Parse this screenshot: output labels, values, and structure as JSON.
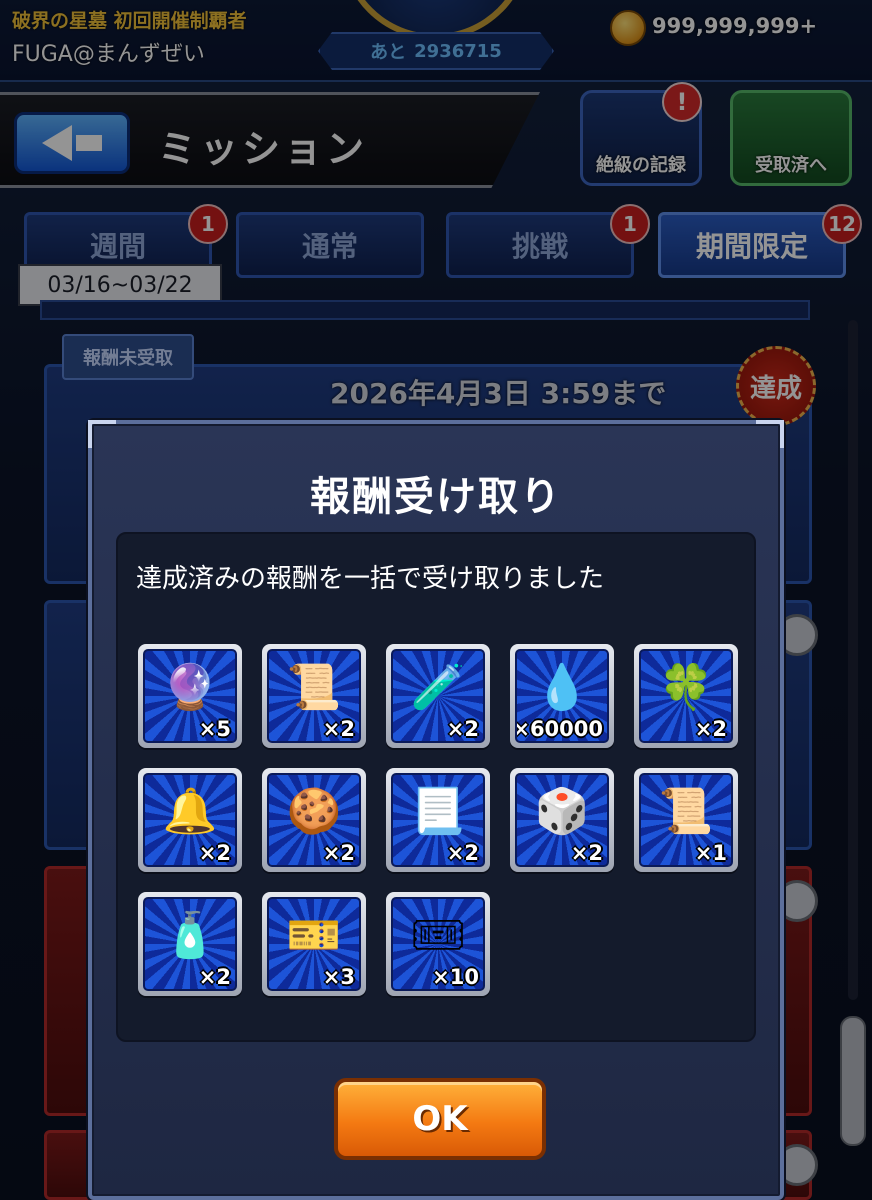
{
  "header": {
    "title_text": "破界の星墓 初回開催制覇者",
    "user_name": "FUGA@まんずぜい",
    "remaining_label": "あと",
    "remaining_value": "2936715",
    "coin_amount": "999,999,999+"
  },
  "mission_bar": {
    "title": "ミッション",
    "records_label": "絶級の記録",
    "records_alert": "!",
    "claimed_label": "受取済へ"
  },
  "tabs": [
    {
      "label": "週間",
      "badge": "1"
    },
    {
      "label": "通常",
      "badge": ""
    },
    {
      "label": "挑戦",
      "badge": "1"
    },
    {
      "label": "期間限定",
      "badge": "12"
    }
  ],
  "date_range": "03/16~03/22",
  "list": {
    "unclaimed_tag": "報酬未受取",
    "deadline": "2026年4月3日 3:59まで",
    "achieved_stamp": "達成"
  },
  "modal": {
    "title": "報酬受け取り",
    "message": "達成済みの報酬を一括で受け取りました",
    "ok_label": "OK",
    "rewards": [
      {
        "icon": "rainbow-orb-icon",
        "glyph": "🔮",
        "qty": "×5"
      },
      {
        "icon": "scroll-icon",
        "glyph": "📜",
        "qty": "×2"
      },
      {
        "icon": "sprout-bottle-icon",
        "glyph": "🧪",
        "qty": "×2"
      },
      {
        "icon": "blue-flame-icon",
        "glyph": "💧",
        "qty": "×60000"
      },
      {
        "icon": "clover-wand-icon",
        "glyph": "🍀",
        "qty": "×2"
      },
      {
        "icon": "bell-icon",
        "glyph": "🔔",
        "qty": "×2"
      },
      {
        "icon": "cookie-icon",
        "glyph": "🍪",
        "qty": "×2"
      },
      {
        "icon": "red-scroll-icon",
        "glyph": "📃",
        "qty": "×2"
      },
      {
        "icon": "dice-icon",
        "glyph": "🎲",
        "qty": "×2"
      },
      {
        "icon": "book-scroll-icon",
        "glyph": "📜",
        "qty": "×1"
      },
      {
        "icon": "el-bottle-icon",
        "glyph": "🧴",
        "qty": "×2"
      },
      {
        "icon": "ticket-icon",
        "glyph": "🎫",
        "qty": "×3"
      },
      {
        "icon": "skip-ticket-icon",
        "glyph": "🎟",
        "qty": "×10"
      }
    ]
  },
  "colors": {
    "ok_button": "#f47a12",
    "tile_blue": "#1d54d8",
    "title_gold": "#f2c23a"
  }
}
